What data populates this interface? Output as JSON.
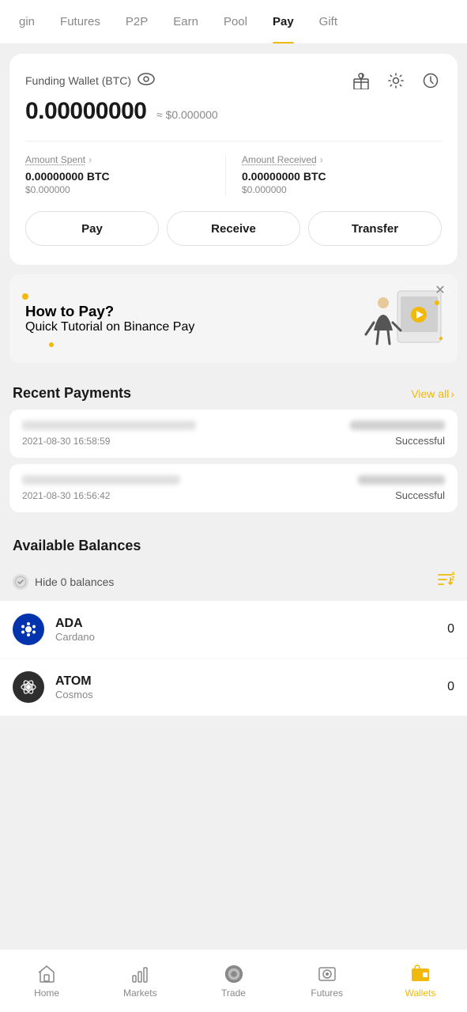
{
  "nav": {
    "items": [
      {
        "label": "gin",
        "active": false
      },
      {
        "label": "Futures",
        "active": false
      },
      {
        "label": "P2P",
        "active": false
      },
      {
        "label": "Earn",
        "active": false
      },
      {
        "label": "Pool",
        "active": false
      },
      {
        "label": "Pay",
        "active": true
      },
      {
        "label": "Gift",
        "active": false
      }
    ]
  },
  "wallet": {
    "title": "Funding Wallet (BTC)",
    "balance_btc": "0.00000000",
    "balance_usd": "≈ $0.000000",
    "spent_label": "Amount Spent",
    "spent_btc": "0.00000000 BTC",
    "spent_usd": "$0.000000",
    "received_label": "Amount Received",
    "received_btc": "0.00000000 BTC",
    "received_usd": "$0.000000"
  },
  "actions": {
    "pay": "Pay",
    "receive": "Receive",
    "transfer": "Transfer"
  },
  "tutorial": {
    "title": "How to Pay?",
    "subtitle": "Quick Tutorial on Binance Pay"
  },
  "recent_payments": {
    "title": "Recent Payments",
    "view_all": "View all",
    "items": [
      {
        "time": "2021-08-30 16:58:59",
        "status": "Successful"
      },
      {
        "time": "2021-08-30 16:56:42",
        "status": "Successful"
      }
    ]
  },
  "available_balances": {
    "title": "Available Balances",
    "hide_zero": "Hide 0 balances",
    "coins": [
      {
        "symbol": "ADA",
        "name": "Cardano",
        "balance": "0"
      },
      {
        "symbol": "ATOM",
        "name": "Cosmos",
        "balance": "0"
      }
    ]
  },
  "bottom_nav": {
    "items": [
      {
        "label": "Home",
        "active": false
      },
      {
        "label": "Markets",
        "active": false
      },
      {
        "label": "Trade",
        "active": false
      },
      {
        "label": "Futures",
        "active": false
      },
      {
        "label": "Wallets",
        "active": true
      }
    ]
  }
}
